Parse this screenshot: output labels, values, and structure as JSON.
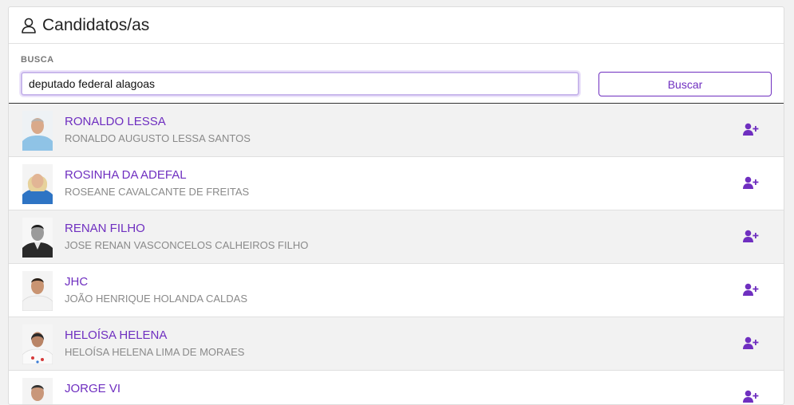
{
  "header": {
    "title": "Candidatos/as",
    "icon": "user-icon"
  },
  "search": {
    "label": "BUSCA",
    "value": "deputado federal alagoas",
    "button_label": "Buscar"
  },
  "colors": {
    "accent": "#6f2fc0",
    "muted_text": "#8a8a8a",
    "row_shade": "#f2f2f2"
  },
  "candidates": [
    {
      "name": "RONALDO LESSA",
      "full_name": "RONALDO AUGUSTO LESSA SANTOS",
      "action_icon": "user-plus-icon"
    },
    {
      "name": "ROSINHA DA ADEFAL",
      "full_name": "ROSEANE CAVALCANTE DE FREITAS",
      "action_icon": "user-plus-icon"
    },
    {
      "name": "RENAN FILHO",
      "full_name": "JOSE RENAN VASCONCELOS CALHEIROS FILHO",
      "action_icon": "user-plus-icon"
    },
    {
      "name": "JHC",
      "full_name": "JOÃO HENRIQUE HOLANDA CALDAS",
      "action_icon": "user-plus-icon"
    },
    {
      "name": "HELOÍSA HELENA",
      "full_name": "HELOÍSA HELENA LIMA DE MORAES",
      "action_icon": "user-plus-icon"
    },
    {
      "name": "JORGE VI",
      "full_name": "",
      "action_icon": "user-plus-icon"
    }
  ]
}
